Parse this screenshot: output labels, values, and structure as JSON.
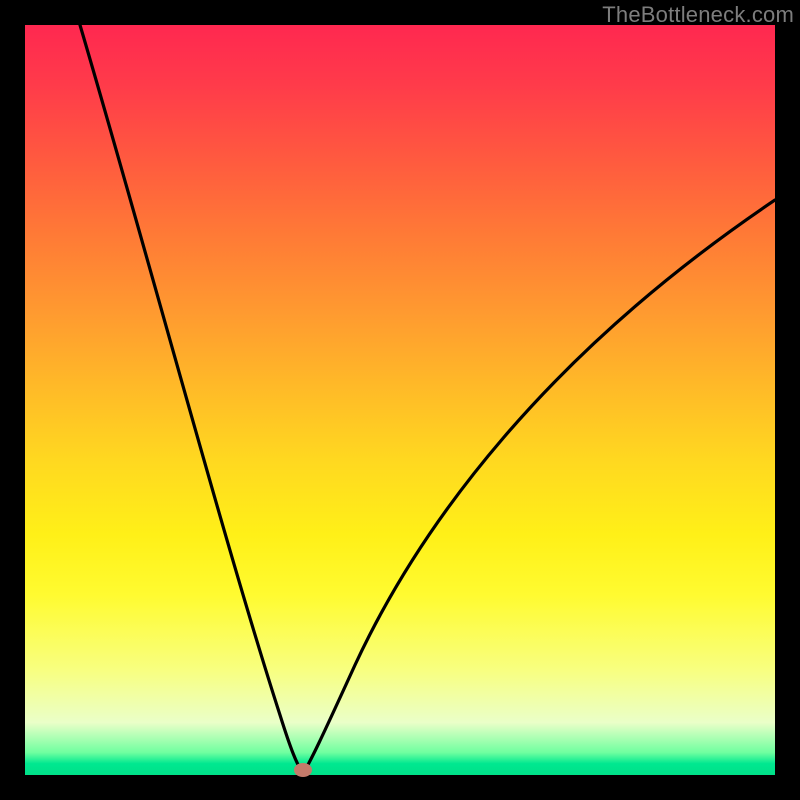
{
  "watermark": "TheBottleneck.com",
  "chart_data": {
    "type": "line",
    "title": "",
    "xlabel": "",
    "ylabel": "",
    "xlim": [
      0,
      100
    ],
    "ylim": [
      0,
      100
    ],
    "grid": false,
    "legend": false,
    "background": "rainbow-vertical-gradient",
    "series": [
      {
        "name": "bottleneck-curve-left",
        "x": [
          0,
          3,
          6,
          9,
          12,
          15,
          18,
          21,
          24,
          27,
          30,
          32,
          34,
          35.5,
          36.3
        ],
        "y": [
          100,
          93,
          85,
          77,
          69,
          61,
          52,
          43,
          34,
          25,
          17,
          11,
          6,
          2,
          0
        ]
      },
      {
        "name": "bottleneck-curve-right",
        "x": [
          36.3,
          38,
          40,
          43,
          47,
          52,
          58,
          65,
          73,
          82,
          91,
          100
        ],
        "y": [
          0,
          4,
          9,
          16,
          24,
          33,
          42,
          51,
          59,
          66,
          72,
          77
        ]
      }
    ],
    "marker": {
      "name": "optimal-point",
      "x": 36.3,
      "y": 0,
      "color": "#c47a6a"
    },
    "gradient_stops": [
      {
        "pos": 0.0,
        "color": "#ff2850"
      },
      {
        "pos": 0.5,
        "color": "#ffc820"
      },
      {
        "pos": 0.8,
        "color": "#fff818"
      },
      {
        "pos": 0.97,
        "color": "#70ffa0"
      },
      {
        "pos": 1.0,
        "color": "#00e088"
      }
    ]
  }
}
